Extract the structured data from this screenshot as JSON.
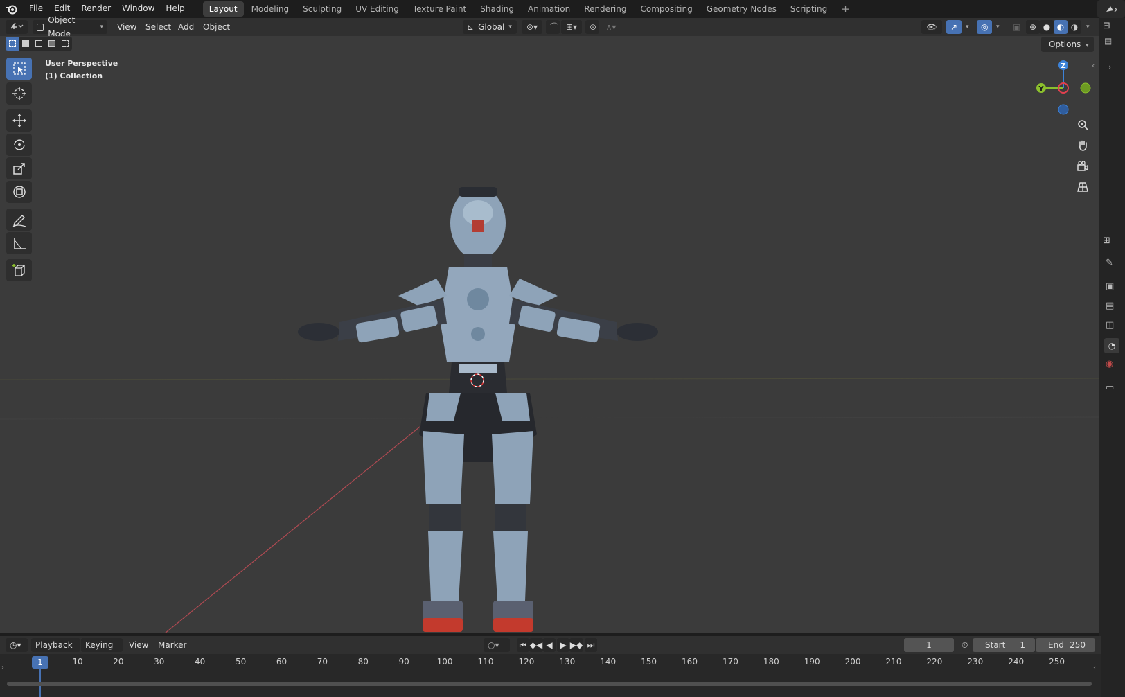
{
  "menubar": {
    "items": [
      "File",
      "Edit",
      "Render",
      "Window",
      "Help"
    ],
    "workspaces": [
      "Layout",
      "Modeling",
      "Sculpting",
      "UV Editing",
      "Texture Paint",
      "Shading",
      "Animation",
      "Rendering",
      "Compositing",
      "Geometry Nodes",
      "Scripting"
    ],
    "active_workspace": "Layout",
    "add_tab": "+"
  },
  "viewport_header": {
    "mode": "Object Mode",
    "menus": [
      "View",
      "Select",
      "Add",
      "Object"
    ],
    "transform_orientation": "Global",
    "options_label": "Options"
  },
  "viewport": {
    "overlay_line1": "User Perspective",
    "overlay_line2": "(1) Collection",
    "gizmo_axes": {
      "z": "Z",
      "y": "Y"
    },
    "axis_colors": {
      "x": "#e2404f",
      "y": "#8bbf2d",
      "z": "#3c82d8"
    }
  },
  "toolbar": {
    "tools": [
      "select-box-icon",
      "cursor-icon",
      "move-icon",
      "rotate-icon",
      "scale-icon",
      "transform-icon",
      "annotate-icon",
      "measure-icon",
      "add-cube-icon"
    ]
  },
  "timeline": {
    "menus": [
      "Playback",
      "Keying",
      "View",
      "Marker"
    ],
    "current_frame": "1",
    "start_label": "Start",
    "start_value": "1",
    "end_label": "End",
    "end_value": "250",
    "ruler_ticks": [
      "10",
      "20",
      "30",
      "40",
      "50",
      "60",
      "70",
      "80",
      "90",
      "100",
      "110",
      "120",
      "130",
      "140",
      "150",
      "160",
      "170",
      "180",
      "190",
      "200",
      "210",
      "220",
      "230",
      "240",
      "250"
    ],
    "playhead_label": "1"
  },
  "colors": {
    "accent": "#4772b3",
    "viewport_bg": "#3b3b3b"
  }
}
